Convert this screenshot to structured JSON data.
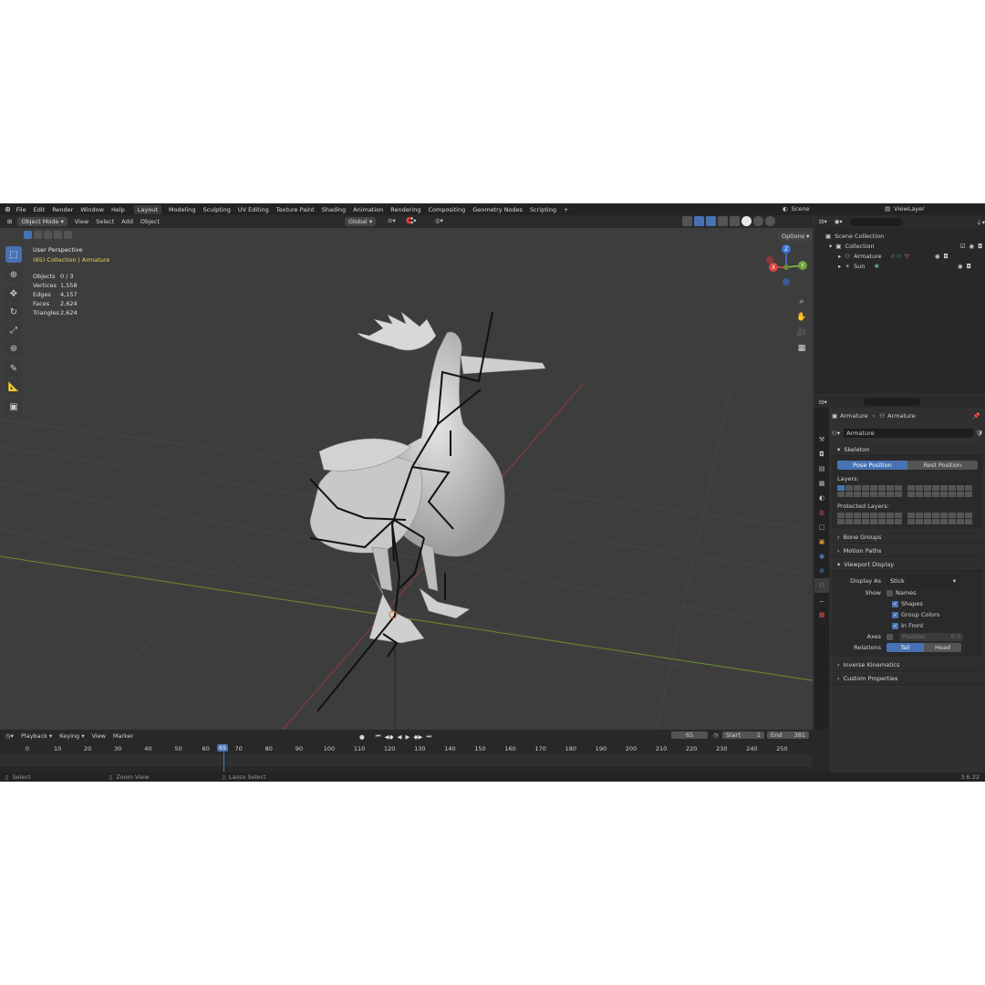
{
  "topbar": {
    "menus": [
      "File",
      "Edit",
      "Render",
      "Window",
      "Help"
    ],
    "workspaces": [
      "Layout",
      "Modeling",
      "Sculpting",
      "UV Editing",
      "Texture Paint",
      "Shading",
      "Animation",
      "Rendering",
      "Compositing",
      "Geometry Nodes",
      "Scripting"
    ],
    "active_workspace": "Layout",
    "add_tab": "+",
    "scene": "Scene",
    "view_layer": "ViewLayer"
  },
  "viewport": {
    "mode": "Object Mode",
    "menus": [
      "View",
      "Select",
      "Add",
      "Object"
    ],
    "transform_orientation": "Global",
    "options": "Options",
    "perspective": "User Perspective",
    "context": "(65) Collection | Armature",
    "stats": [
      {
        "label": "Objects",
        "value": "0 / 3"
      },
      {
        "label": "Vertices",
        "value": "1,558"
      },
      {
        "label": "Edges",
        "value": "4,157"
      },
      {
        "label": "Faces",
        "value": "2,624"
      },
      {
        "label": "Triangles",
        "value": "2,624"
      }
    ],
    "gizmo": {
      "x": "X",
      "y": "Y",
      "z": "Z"
    }
  },
  "outliner": {
    "root": "Scene Collection",
    "collection": "Collection",
    "items": [
      "Armature",
      "Sun"
    ]
  },
  "properties": {
    "breadcrumb": [
      "Armature",
      "Armature"
    ],
    "name_field": "Armature",
    "skeleton": {
      "title": "Skeleton",
      "pose_position": "Pose Position",
      "rest_position": "Rest Position",
      "layers": "Layers:",
      "protected_layers": "Protected Layers:"
    },
    "collapsed_sections": [
      "Bone Groups",
      "Motion Paths"
    ],
    "viewport_display": {
      "title": "Viewport Display",
      "display_as_label": "Display As",
      "display_as_value": "Stick",
      "show_label": "Show",
      "show_items": [
        {
          "label": "Names",
          "checked": false
        },
        {
          "label": "Shapes",
          "checked": true
        },
        {
          "label": "Group Colors",
          "checked": true
        },
        {
          "label": "In Front",
          "checked": true
        }
      ],
      "axes_label": "Axes",
      "axes_position_label": "Position",
      "axes_position_value": "0.0",
      "relations_label": "Relations",
      "relations_tail": "Tail",
      "relations_head": "Head"
    },
    "bottom_sections": [
      "Inverse Kinematics",
      "Custom Properties"
    ]
  },
  "timeline": {
    "menus": [
      "Playback",
      "Keying",
      "View",
      "Marker"
    ],
    "current_frame": "65",
    "start_label": "Start",
    "start_value": "1",
    "end_label": "End",
    "end_value": "381",
    "ticks": [
      "0",
      "10",
      "20",
      "30",
      "40",
      "50",
      "60",
      "70",
      "80",
      "90",
      "100",
      "110",
      "120",
      "130",
      "140",
      "150",
      "160",
      "170",
      "180",
      "190",
      "200",
      "210",
      "220",
      "230",
      "240",
      "250"
    ]
  },
  "statusbar": {
    "select": "Select",
    "zoom": "Zoom View",
    "lasso": "Lasso Select",
    "version": "3.6.22"
  }
}
